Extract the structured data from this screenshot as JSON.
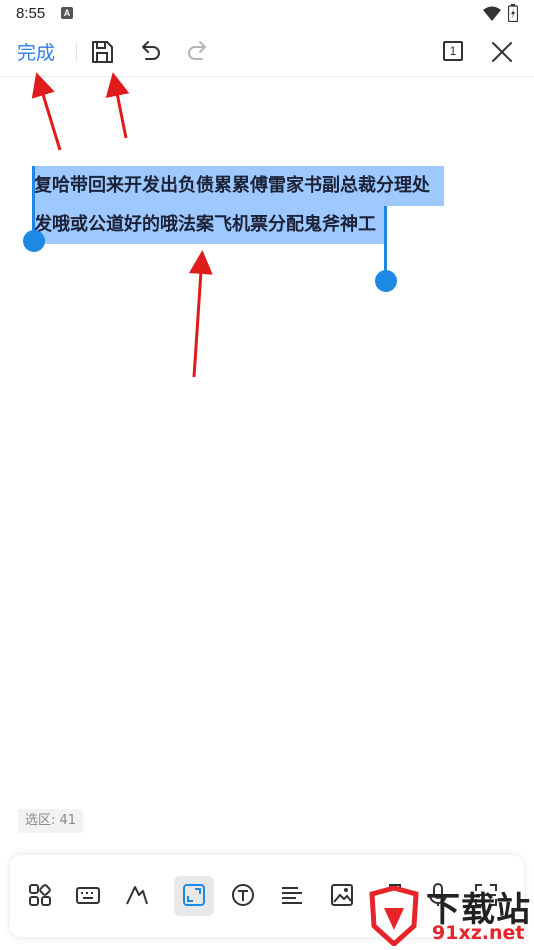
{
  "status_bar": {
    "time": "8:55",
    "notification_badge": "A"
  },
  "toolbar": {
    "done_label": "完成",
    "page_count": "1",
    "icons": [
      "save-icon",
      "undo-icon",
      "redo-icon",
      "page-count-icon",
      "close-icon"
    ]
  },
  "editor": {
    "selected_lines": [
      "复哈带回来开发出负债累累傅雷家书副总裁分理处",
      "发哦或公道好的哦法案飞机票分配鬼斧神工"
    ],
    "selection_color": "#9ec9ff",
    "handle_color": "#1e88e5"
  },
  "selection_info": {
    "label": "选区: 41"
  },
  "bottom_toolbar": {
    "icons": [
      "grid-icon",
      "keyboard-icon",
      "pen-icon",
      "select-frame-icon",
      "text-icon",
      "align-icon",
      "image-icon",
      "shapes-icon",
      "mic-icon",
      "scan-icon"
    ],
    "active": "select-frame-icon"
  },
  "annotation_color": "#e01b1b",
  "watermark": {
    "brand": "下载站",
    "site": "91xz.net"
  },
  "colors": {
    "accent": "#2f7fe8"
  }
}
